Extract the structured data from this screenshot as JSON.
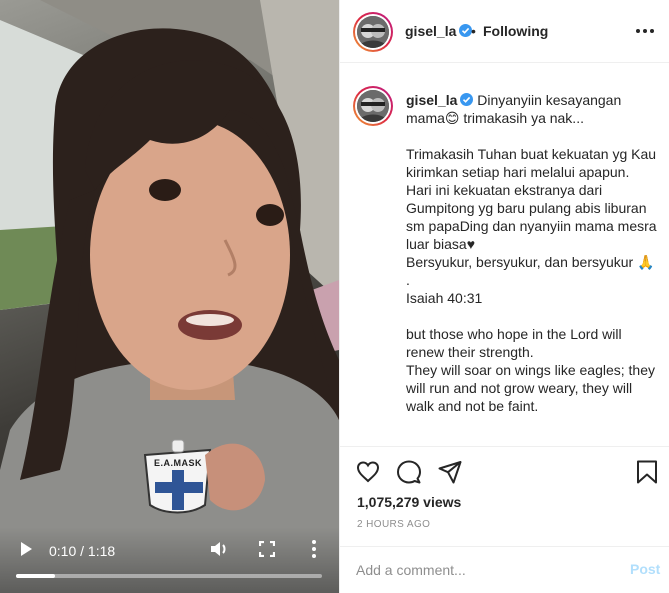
{
  "post": {
    "username": "gisel_la",
    "follow_status": "Following",
    "header_dot": "•",
    "caption_text": " Dinyanyiin kesayangan mama😊 trimakasih ya nak...\n\nTrimakasih Tuhan buat kekuatan yg Kau kirimkan setiap hari melalui apapun.\nHari ini kekuatan ekstranya dari Gumpitong yg baru pulang abis liburan sm papaDing dan nyanyiin mama mesra luar biasa♥\nBersyukur, bersyukur, dan bersyukur 🙏\n.\nIsaiah 40:31\n\nbut those who hope in the Lord will renew their strength.\nThey will soar on wings like eagles; they will run and not grow weary, they will walk and not be faint.",
    "views": "1,075,279 views",
    "timestamp": "2 HOURS AGO"
  },
  "video": {
    "time_display": "0:10 / 1:18",
    "progress": 0.128,
    "shirt_badge_text": "E.A.MASK"
  },
  "comment": {
    "placeholder": "Add a comment...",
    "post_label": "Post"
  },
  "icons": {
    "play": "play-icon",
    "volume": "volume-icon",
    "fullscreen": "fullscreen-icon",
    "more_vertical": "more-vertical-icon",
    "more_horizontal": "more-horizontal-icon",
    "verified": "verified-badge-icon",
    "like": "heart-icon",
    "comment": "comment-icon",
    "share": "share-icon",
    "save": "bookmark-icon"
  },
  "colors": {
    "verified_blue": "#3897f0",
    "post_button_disabled": "#b2dffc",
    "secondary_text": "#8e8e8e"
  }
}
